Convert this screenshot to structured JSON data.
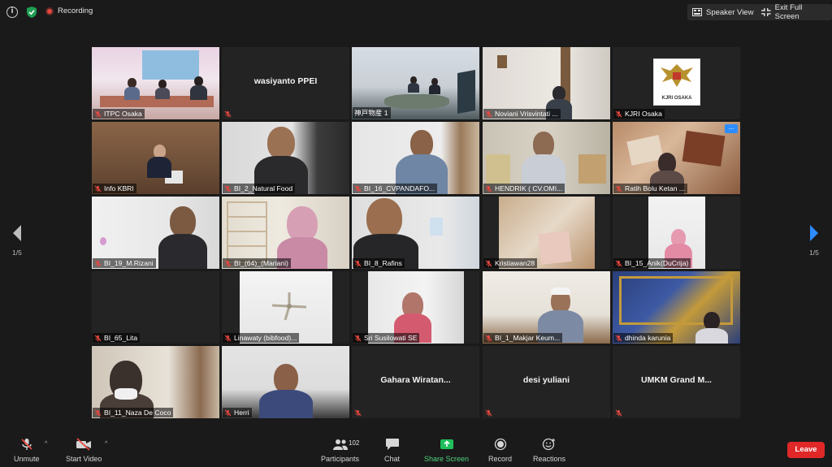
{
  "topbar": {
    "recording_label": "Recording",
    "speaker_view_label": "Speaker View",
    "exit_full_screen_label": "Exit Full Screen"
  },
  "pagination": {
    "left_page": "1/5",
    "right_page": "1/5"
  },
  "participants": [
    {
      "name": "ITPC Osaka",
      "video": true,
      "muted": true
    },
    {
      "name": "wasiyanto PPEI",
      "video": false,
      "muted": true
    },
    {
      "name": "神戸物産 1",
      "video": true,
      "muted": false,
      "active_speaker": true
    },
    {
      "name": "Noviani Vrisvintati ...",
      "video": true,
      "muted": true
    },
    {
      "name": "KJRI Osaka",
      "video": true,
      "muted": true,
      "logo_text": "KJRI OSAKA"
    },
    {
      "name": "Info KBRI",
      "video": true,
      "muted": true
    },
    {
      "name": "BI_2_Natural Food",
      "video": true,
      "muted": true
    },
    {
      "name": "BI_16_CVPANDAFO...",
      "video": true,
      "muted": true
    },
    {
      "name": "HENDRIK ( CV.OMI...",
      "video": true,
      "muted": true
    },
    {
      "name": "Ratih Bolu Ketan ...",
      "video": true,
      "muted": true,
      "more_button": "..."
    },
    {
      "name": "BI_19_M.Rizani",
      "video": true,
      "muted": true
    },
    {
      "name": "BI_(64)_(Mariani)",
      "video": true,
      "muted": true
    },
    {
      "name": "BI_8_Rafins",
      "video": true,
      "muted": true
    },
    {
      "name": "Kristiawan28",
      "video": true,
      "muted": true
    },
    {
      "name": "BI_15_Anik(DuCrija)",
      "video": true,
      "muted": true
    },
    {
      "name": "BI_65_Lita",
      "video": true,
      "muted": true
    },
    {
      "name": "Linawaty (bibfood)...",
      "video": true,
      "muted": true
    },
    {
      "name": "Sri Susilowati SE",
      "video": true,
      "muted": true
    },
    {
      "name": "BI_1_Makjar Keum...",
      "video": true,
      "muted": true
    },
    {
      "name": "dhinda karunia",
      "video": true,
      "muted": true
    },
    {
      "name": "BI_11_Naza De Coco",
      "video": true,
      "muted": true
    },
    {
      "name": "Herri",
      "video": true,
      "muted": true
    },
    {
      "name": "Gahara Wiratan...",
      "video": false,
      "muted": true
    },
    {
      "name": "desi yuliani",
      "video": false,
      "muted": true
    },
    {
      "name": "UMKM Grand M...",
      "video": false,
      "muted": true
    }
  ],
  "toolbar": {
    "unmute_label": "Unmute",
    "start_video_label": "Start Video",
    "participants_label": "Participants",
    "participants_count": "102",
    "chat_label": "Chat",
    "share_screen_label": "Share Screen",
    "record_label": "Record",
    "reactions_label": "Reactions",
    "leave_label": "Leave"
  },
  "colors": {
    "background": "#1a1a1a",
    "tile_background": "#232323",
    "active_speaker_border": "#c6d85c",
    "mute_red": "#e8483f",
    "share_green": "#4fd17a",
    "leave_red": "#e02828",
    "accent_blue": "#2d8cff"
  }
}
